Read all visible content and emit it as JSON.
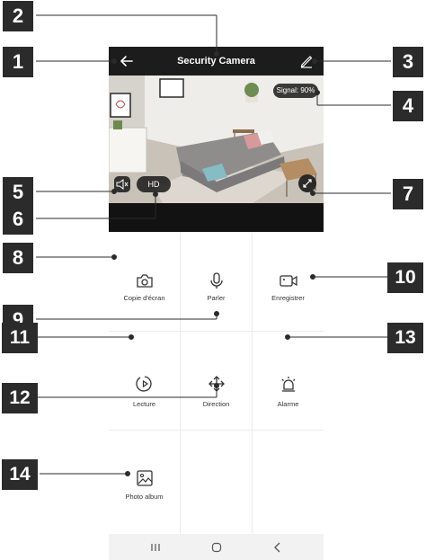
{
  "app": {
    "title": "Security Camera",
    "signal": "Signal: 90%",
    "quality": "HD"
  },
  "icons": {
    "back": "back-arrow-icon",
    "edit": "edit-pencil-icon",
    "mute": "speaker-mute-icon",
    "fullscreen": "fullscreen-icon"
  },
  "actions": [
    {
      "label": "Copie d'écran",
      "icon": "camera-snapshot-icon"
    },
    {
      "label": "Parler",
      "icon": "microphone-icon"
    },
    {
      "label": "Enregistrer",
      "icon": "video-record-icon"
    },
    {
      "label": "Lecture",
      "icon": "playback-icon"
    },
    {
      "label": "Direction",
      "icon": "move-direction-icon"
    },
    {
      "label": "Alarme",
      "icon": "alarm-icon"
    },
    {
      "label": "Photo album",
      "icon": "photo-album-icon"
    }
  ],
  "navbar": {
    "recents": "recents-icon",
    "home": "home-icon",
    "back": "nav-back-icon"
  },
  "callouts": [
    "1",
    "2",
    "3",
    "4",
    "5",
    "6",
    "7",
    "8",
    "9",
    "10",
    "11",
    "12",
    "13",
    "14"
  ]
}
